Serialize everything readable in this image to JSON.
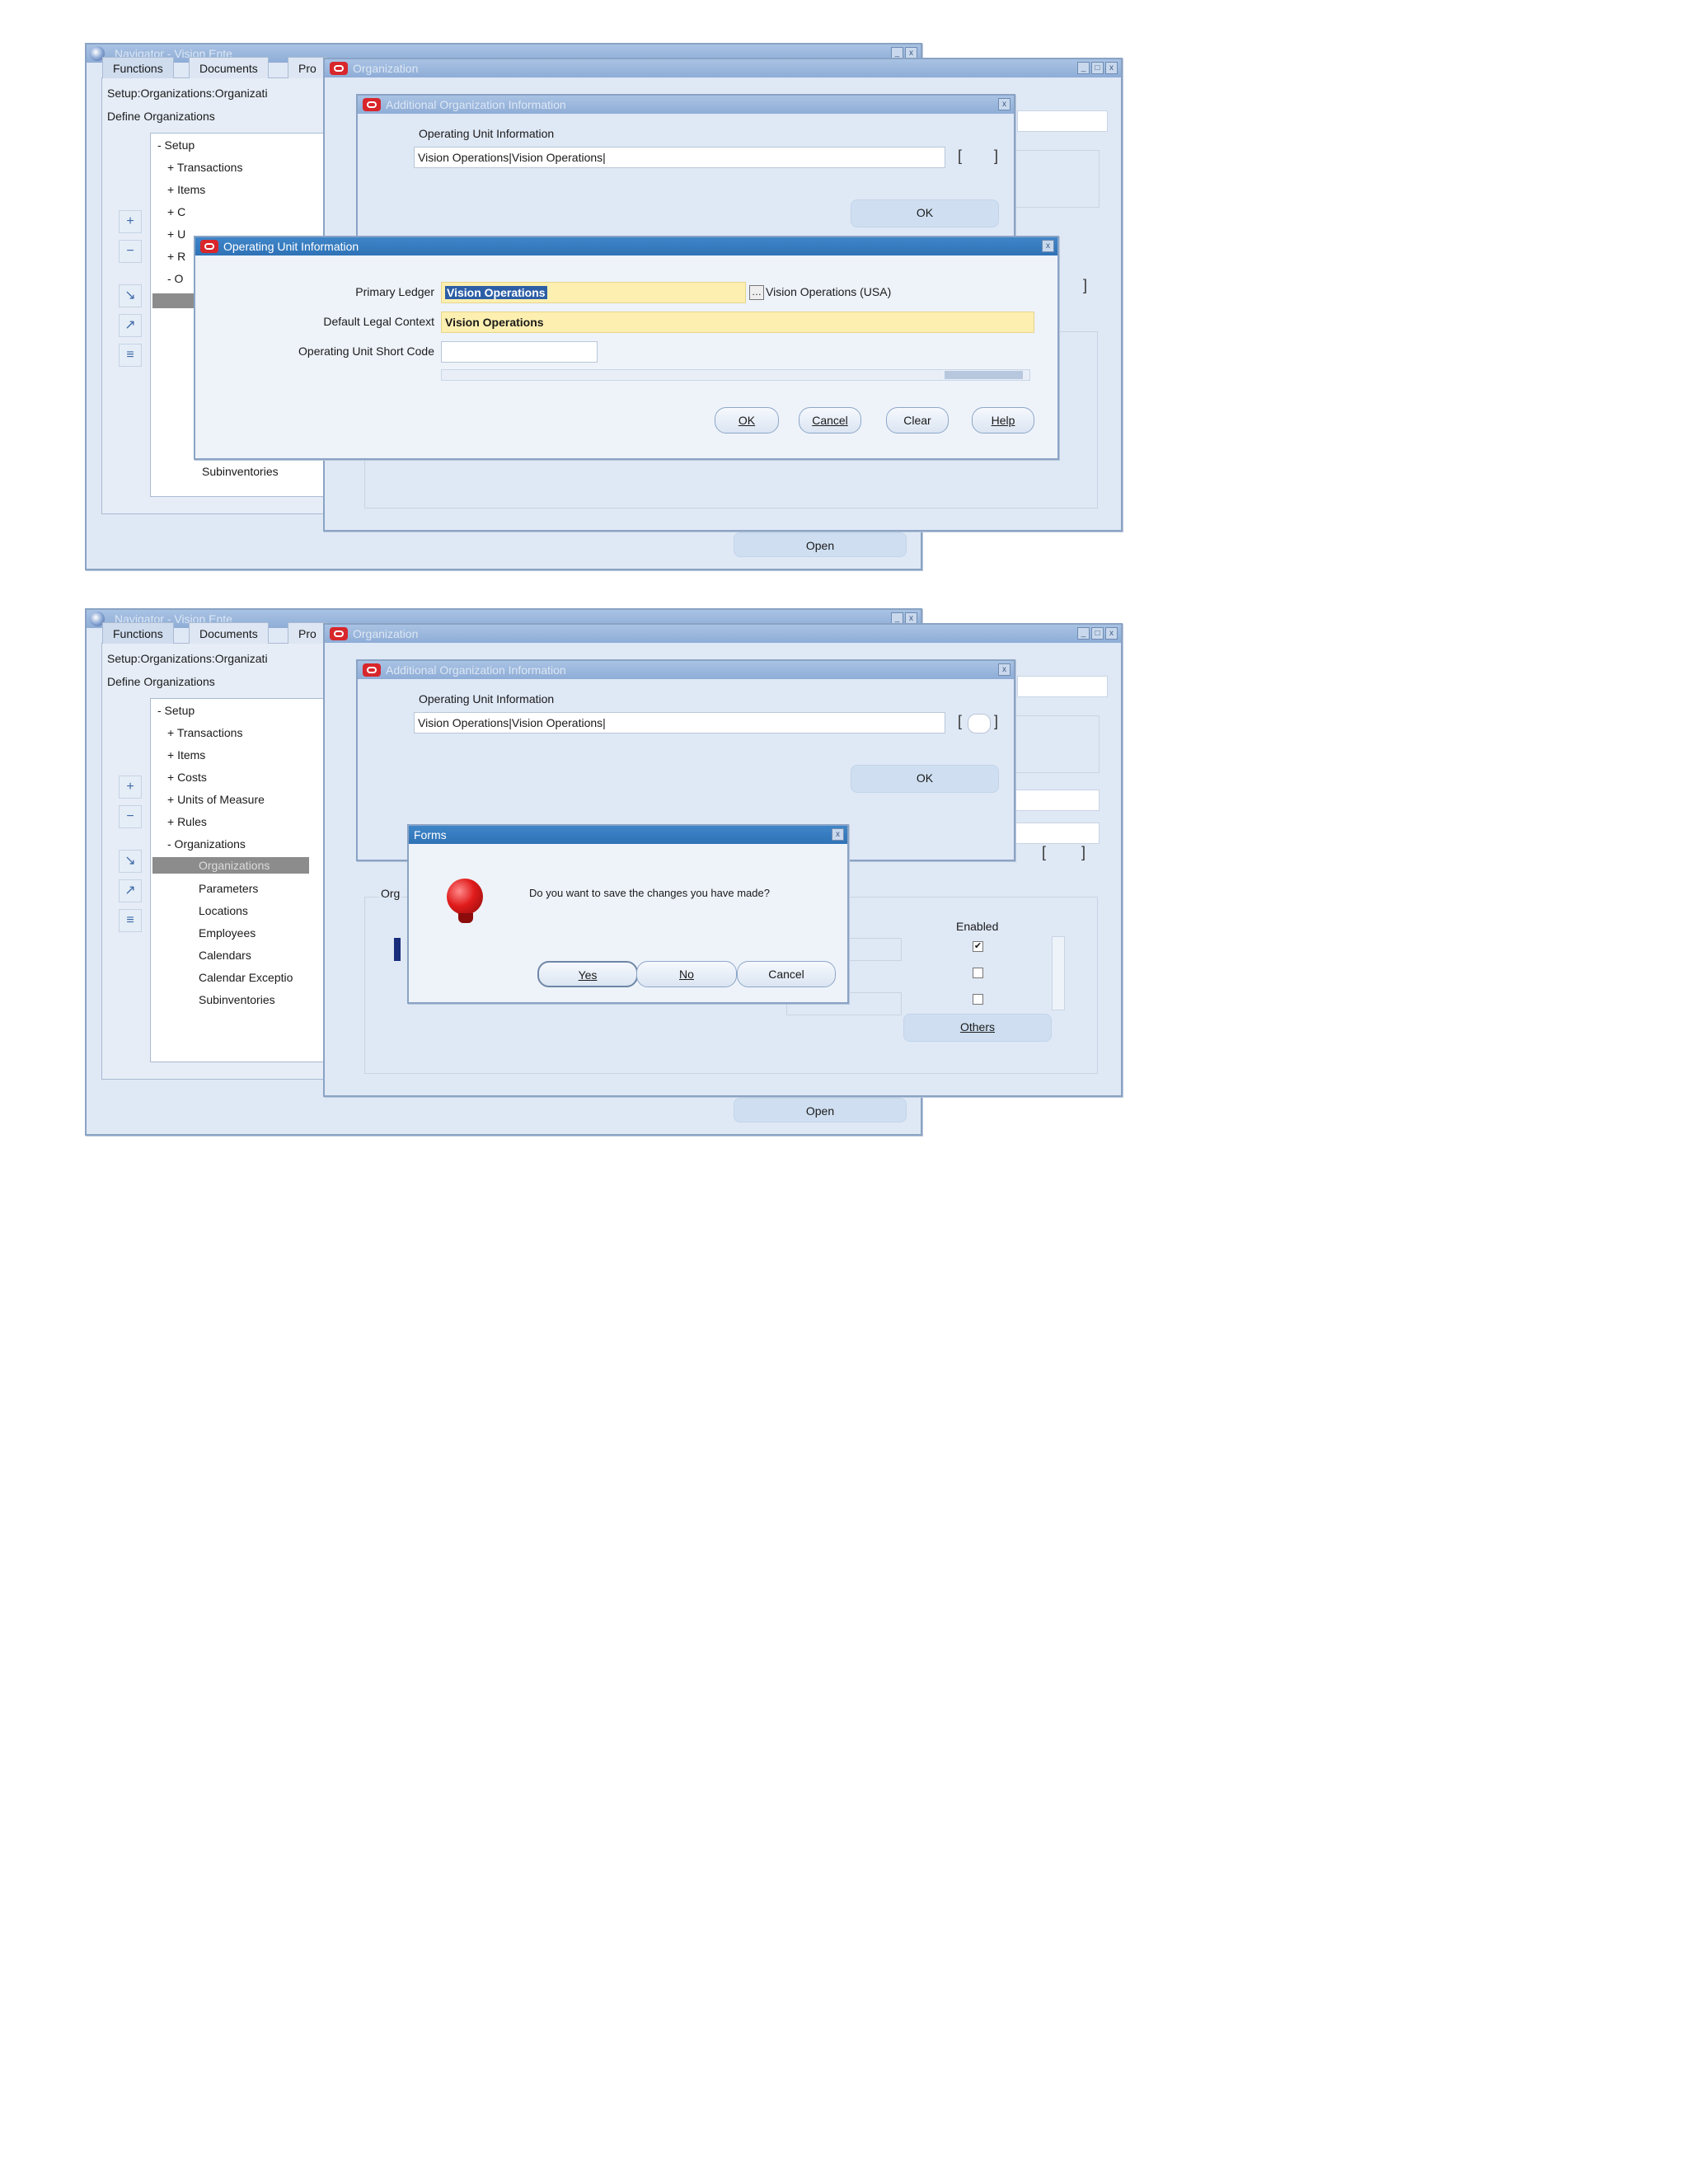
{
  "screens": [
    {
      "navigator": {
        "title": "Navigator - Vision Ente",
        "tabs": [
          "Functions",
          "Documents",
          "Pro"
        ],
        "path": "Setup:Organizations:Organizati",
        "heading": "Define Organizations",
        "tree": [
          "- Setup",
          "+ Transactions",
          "+ Items",
          "+ C",
          "+ U",
          "+ R",
          "- O"
        ],
        "tree_tail": "Subinventories",
        "open_button": "Open"
      },
      "org_window": {
        "title": "Organization",
        "enabled_label": "",
        "others_button": ""
      },
      "add_info": {
        "title": "Additional Organization Information",
        "label": "Operating Unit Information",
        "value": "Vision Operations|Vision Operations|",
        "ok_button": "OK"
      },
      "ou_dialog": {
        "title": "Operating Unit Information",
        "primary_ledger_label": "Primary Ledger",
        "primary_ledger_value": "Vision Operations",
        "primary_ledger_desc": "Vision Operations (USA)",
        "legal_context_label": "Default Legal Context",
        "legal_context_value": "Vision Operations",
        "short_code_label": "Operating Unit Short Code",
        "short_code_value": "",
        "ok_button": "OK",
        "cancel_button": "Cancel",
        "clear_button": "Clear",
        "help_button": "Help"
      }
    },
    {
      "navigator": {
        "title": "Navigator - Vision Ente",
        "tabs": [
          "Functions",
          "Documents",
          "Pro"
        ],
        "path": "Setup:Organizations:Organizati",
        "heading": "Define Organizations",
        "tree": [
          "- Setup",
          "+ Transactions",
          "+ Items",
          "+ Costs",
          "+ Units of Measure",
          "+ Rules",
          "- Organizations"
        ],
        "tree_children": [
          "Organizations",
          "Parameters",
          "Locations",
          "Employees",
          "Calendars",
          "Calendar Exceptio",
          "Subinventories"
        ],
        "open_button": "Open"
      },
      "org_window": {
        "title": "Organization",
        "section_label": "Org",
        "enabled_label": "Enabled",
        "others_button": "Others",
        "enabled_rows": [
          true,
          false,
          false
        ]
      },
      "add_info": {
        "title": "Additional Organization Information",
        "label": "Operating Unit Information",
        "value": "Vision Operations|Vision Operations|",
        "ok_button": "OK"
      },
      "forms_dialog": {
        "title": "Forms",
        "message": "Do you want to save the changes you have made?",
        "yes_button": "Yes",
        "no_button": "No",
        "cancel_button": "Cancel"
      }
    }
  ],
  "colors": {
    "titlebar_active": "#2f72b6",
    "field_required": "#fdefb0",
    "selection": "#2c5ea6"
  }
}
